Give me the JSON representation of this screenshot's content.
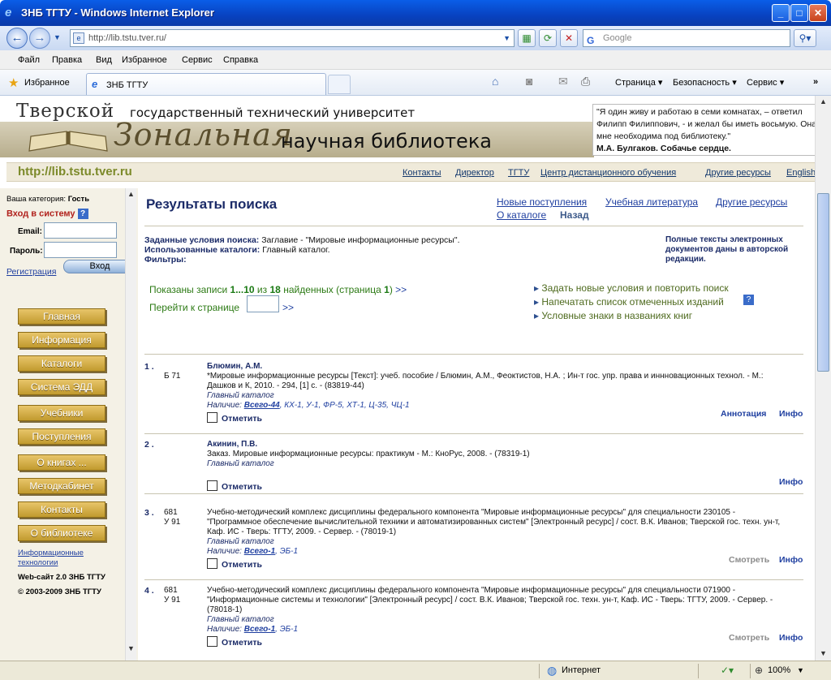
{
  "browser": {
    "title": "ЗНБ ТГТУ - Windows Internet Explorer",
    "address": "http://lib.tstu.tver.ru/",
    "search_placeholder": "Google",
    "menu": [
      "Файл",
      "Правка",
      "Вид",
      "Избранное",
      "Сервис",
      "Справка"
    ],
    "favorites_label": "Избранное",
    "tab_title": "ЗНБ ТГТУ",
    "commands": [
      "Страница",
      "Безопасность",
      "Сервис"
    ],
    "status_zone": "Интернет",
    "zoom": "100%"
  },
  "banner": {
    "top_word": "Тверской",
    "top_rest": "государственный технический университет",
    "zonal": "Зональная",
    "library": "научная библиотека",
    "quote": "\"Я один живу и работаю в семи комнатах, – ответил Филипп Филиппович, - и желал бы иметь восьмую. Она мне необходима под библиотеку.\"",
    "quote_author": "М.А. Булгаков. Собачье сердце."
  },
  "topnav": {
    "site": "http://lib.tstu.tver.ru",
    "links": [
      "Контакты",
      "Директор",
      "ТГТУ",
      "Центр дистанционного обучения",
      "Другие ресурсы",
      "English"
    ]
  },
  "sidebar": {
    "category_label": "Ваша категория:",
    "category_value": "Гость",
    "login_title": "Вход в систему",
    "help": "?",
    "email_label": "Email:",
    "password_label": "Пароль:",
    "register": "Регистрация",
    "login_button": "Вход",
    "buttons": [
      "Главная",
      "Информация",
      "Каталоги",
      "Система ЭДД",
      "Учебники",
      "Поступления",
      "О книгах ...",
      "Методкабинет",
      "Контакты",
      "О библиотеке"
    ],
    "info_link_1": "Информационные",
    "info_link_2": "технологии",
    "website": "Web-сайт 2.0 ЗНБ ТГТУ",
    "copyright": "© 2003-2009 ЗНБ ТГТУ"
  },
  "main": {
    "title": "Результаты поиска",
    "links": [
      "Новые поступления",
      "Учебная литература",
      "Другие ресурсы",
      "О каталоге",
      "Назад"
    ],
    "cond_label": "Заданные условия поиска:",
    "cond_value": "Заглавие - \"Мировые информационные ресурсы\".",
    "catalogs_label": "Использованные каталоги:",
    "catalogs_value": "Главный каталог.",
    "filters_label": "Фильтры:",
    "fulltext": "Полные тексты электронных документов даны в авторской редакции.",
    "shown_prefix": "Показаны записи",
    "shown_range": "1...10",
    "shown_of": "из",
    "shown_total": "18",
    "shown_suffix": "найденных (страница",
    "shown_page": "1",
    "shown_close": ")",
    "next": ">>",
    "goto_label": "Перейти к странице",
    "goto_next": ">>",
    "actions": [
      "Задать новые условия и повторить поиск",
      "Напечатать список отмеченных изданий",
      "Условные знаки в названиях книг"
    ],
    "help": "?"
  },
  "records": [
    {
      "num": "1 .",
      "code1": "Б 71",
      "code2": "",
      "author": "Блюмин, А.М.",
      "text": "*Мировые информационные ресурсы [Текст]: учеб. пособие / Блюмин, А.М., Феоктистов, Н.А. ; Ин-т гос. упр. права и иннновационных технол. - М.: Дашков и К, 2010. - 294, [1] с. - (83819-44)",
      "catalog": "Главный каталог",
      "avail_label": "Наличие:",
      "avail_total": "Всего-44",
      "avail_rest": ", КХ-1, У-1, ФР-5, ХТ-1, Ц-35, ЧЦ-1",
      "mark": "Отметить",
      "action1": "Аннотация",
      "action2": "Инфо"
    },
    {
      "num": "2 .",
      "code1": "",
      "code2": "",
      "author": "Акинин, П.В.",
      "text": "Заказ. Мировые информационные ресурсы: практикум - М.: КноРус, 2008. - (78319-1)",
      "catalog": "Главный каталог",
      "avail_label": "",
      "avail_total": "",
      "avail_rest": "",
      "mark": "Отметить",
      "action1": "",
      "action2": "Инфо"
    },
    {
      "num": "3 .",
      "code1": "681",
      "code2": "У 91",
      "author": "",
      "text": "Учебно-методический комплекс дисциплины федерального компонента \"Мировые информационные ресурсы\" для специальности 230105 - \"Программное обеспечение вычислительной техники и автоматизированных систем\" [Электронный ресурс] / сост. В.К. Иванов; Тверской гос. техн. ун-т, Каф. ИС - Тверь: ТГТУ, 2009. - Сервер. - (78019-1)",
      "catalog": "Главный каталог",
      "avail_label": "Наличие:",
      "avail_total": "Всего-1",
      "avail_rest": ", ЭБ-1",
      "mark": "Отметить",
      "action1": "Смотреть",
      "action2": "Инфо"
    },
    {
      "num": "4 .",
      "code1": "681",
      "code2": "У 91",
      "author": "",
      "text": "Учебно-методический комплекс дисциплины федерального компонента \"Мировые информационные ресурсы\" для специальности 071900 - \"Информационные системы и технологии\" [Электронный ресурс] / сост. В.К. Иванов; Тверской гос. техн. ун-т, Каф. ИС - Тверь: ТГТУ, 2009. - Сервер. - (78018-1)",
      "catalog": "Главный каталог",
      "avail_label": "Наличие:",
      "avail_total": "Всего-1",
      "avail_rest": ", ЭБ-1",
      "mark": "Отметить",
      "action1": "Смотреть",
      "action2": "Инфо"
    }
  ]
}
